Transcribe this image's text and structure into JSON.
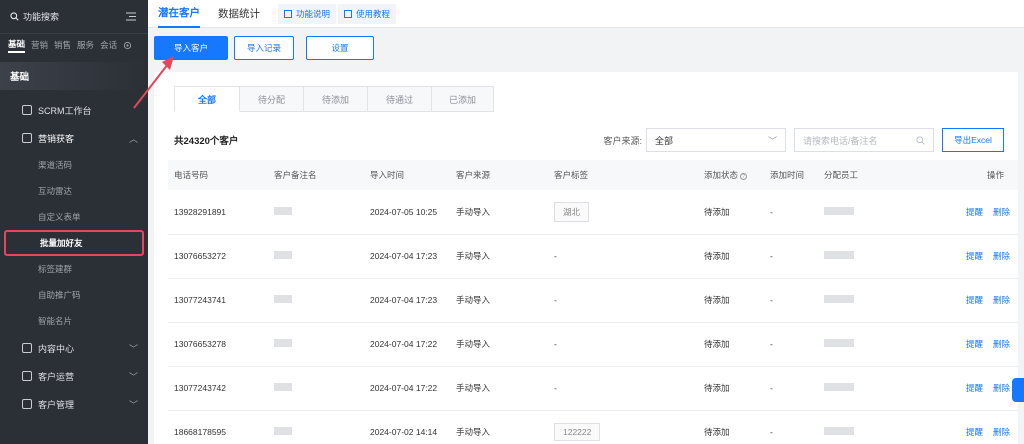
{
  "sidebar": {
    "search_label": "功能搜索",
    "categories": [
      "基础",
      "营销",
      "销售",
      "服务",
      "会话"
    ],
    "section": "基础",
    "items": [
      {
        "label": "SCRM工作台",
        "icon": "workbench-icon"
      },
      {
        "label": "营销获客",
        "icon": "marketing-icon"
      }
    ],
    "sub_items": [
      "渠道活码",
      "互动雷达",
      "自定义表单",
      "批量加好友",
      "标签建群",
      "自助推广码",
      "智能名片"
    ],
    "bottom_items": [
      "内容中心",
      "客户运营",
      "客户管理"
    ]
  },
  "topbar": {
    "tabs": [
      "潜在客户",
      "数据统计"
    ],
    "help_buttons": [
      "功能说明",
      "使用教程"
    ]
  },
  "actions": {
    "import": "导入客户",
    "records": "导入记录",
    "settings": "设置"
  },
  "filter_tabs": [
    "全部",
    "待分配",
    "待添加",
    "待通过",
    "已添加"
  ],
  "filters": {
    "total": "共24320个客户",
    "source_label": "客户来源:",
    "source_value": "全部",
    "search_placeholder": "请搜索电话/备注名",
    "export": "导出Excel"
  },
  "table": {
    "headers": [
      "电话号码",
      "客户备注名",
      "导入时间",
      "客户来源",
      "客户标签",
      "添加状态",
      "添加时间",
      "分配员工",
      "操作"
    ],
    "rows": [
      {
        "phone": "13928291891",
        "time": "2024-07-05 10:25",
        "source": "手动导入",
        "tag": "湖北",
        "status": "待添加",
        "added": "-"
      },
      {
        "phone": "13076653272",
        "time": "2024-07-04 17:23",
        "source": "手动导入",
        "tag": "-",
        "status": "待添加",
        "added": "-"
      },
      {
        "phone": "13077243741",
        "time": "2024-07-04 17:23",
        "source": "手动导入",
        "tag": "-",
        "status": "待添加",
        "added": "-"
      },
      {
        "phone": "13076653278",
        "time": "2024-07-04 17:22",
        "source": "手动导入",
        "tag": "-",
        "status": "待添加",
        "added": "-"
      },
      {
        "phone": "13077243742",
        "time": "2024-07-04 17:22",
        "source": "手动导入",
        "tag": "-",
        "status": "待添加",
        "added": "-"
      },
      {
        "phone": "18668178595",
        "time": "2024-07-02 14:14",
        "source": "手动导入",
        "tag": "122222",
        "status": "待添加",
        "added": "-"
      }
    ],
    "op_remind": "提醒",
    "op_delete": "删除"
  },
  "colors": {
    "accent": "#1677ff",
    "sidebar": "#2b2f36",
    "annotation": "#e2485a"
  }
}
